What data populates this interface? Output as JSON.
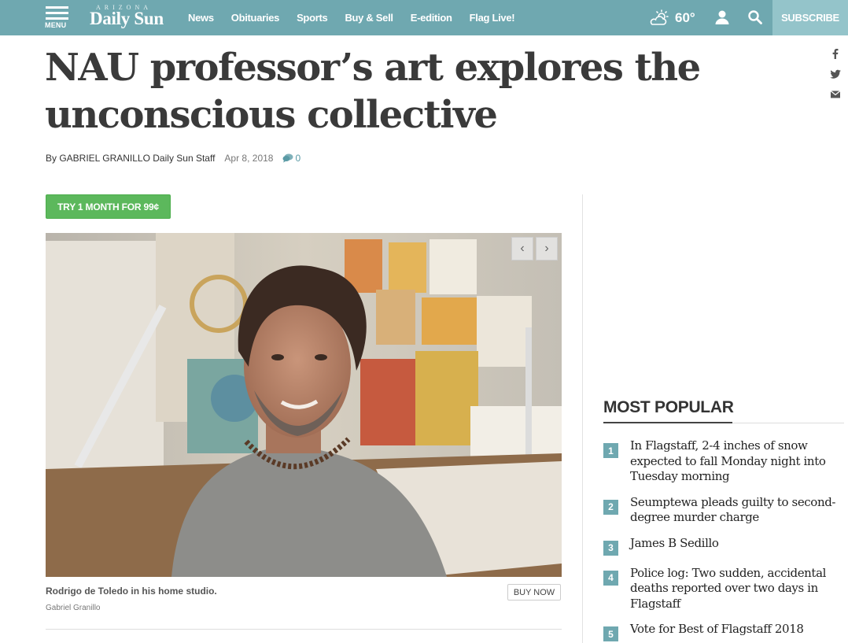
{
  "header": {
    "menu_label": "MENU",
    "logo_state": "ARIZONA",
    "logo_name": "Daily Sun",
    "nav": [
      "News",
      "Obituaries",
      "Sports",
      "Buy & Sell",
      "E-edition",
      "Flag Live!"
    ],
    "weather_icon": "partly-cloudy-icon",
    "temperature": "60°",
    "subscribe_label": "SUBSCRIBE"
  },
  "share": [
    "facebook-icon",
    "twitter-icon",
    "email-icon"
  ],
  "article": {
    "headline": "NAU professor’s art explores the unconscious collective",
    "byline": "By GABRIEL GRANILLO Daily Sun Staff",
    "date": "Apr 8, 2018",
    "comment_count": "0",
    "promo_button": "TRY 1 MONTH FOR 99¢",
    "photo": {
      "caption": "Rodrigo de Toledo in his home studio.",
      "credit": "Gabriel Granillo",
      "buy_label": "BUY NOW",
      "prev_arrow": "‹",
      "next_arrow": "›"
    }
  },
  "most_popular": {
    "title": "MOST POPULAR",
    "items": [
      {
        "rank": "1",
        "title": "In Flagstaff, 2-4 inches of snow expected to fall Monday night into Tuesday morning"
      },
      {
        "rank": "2",
        "title": "Seumptewa pleads guilty to second-degree murder charge"
      },
      {
        "rank": "3",
        "title": "James B Sedillo"
      },
      {
        "rank": "4",
        "title": "Police log: Two sudden, accidental deaths reported over two days in Flagstaff"
      },
      {
        "rank": "5",
        "title": "Vote for Best of Flagstaff 2018"
      }
    ]
  },
  "colors": {
    "nav_bar": "#6fa8b0",
    "subscribe_bg": "#94c4ca",
    "promo_green": "#5cb85c",
    "rank_badge": "#6fa8b0"
  }
}
